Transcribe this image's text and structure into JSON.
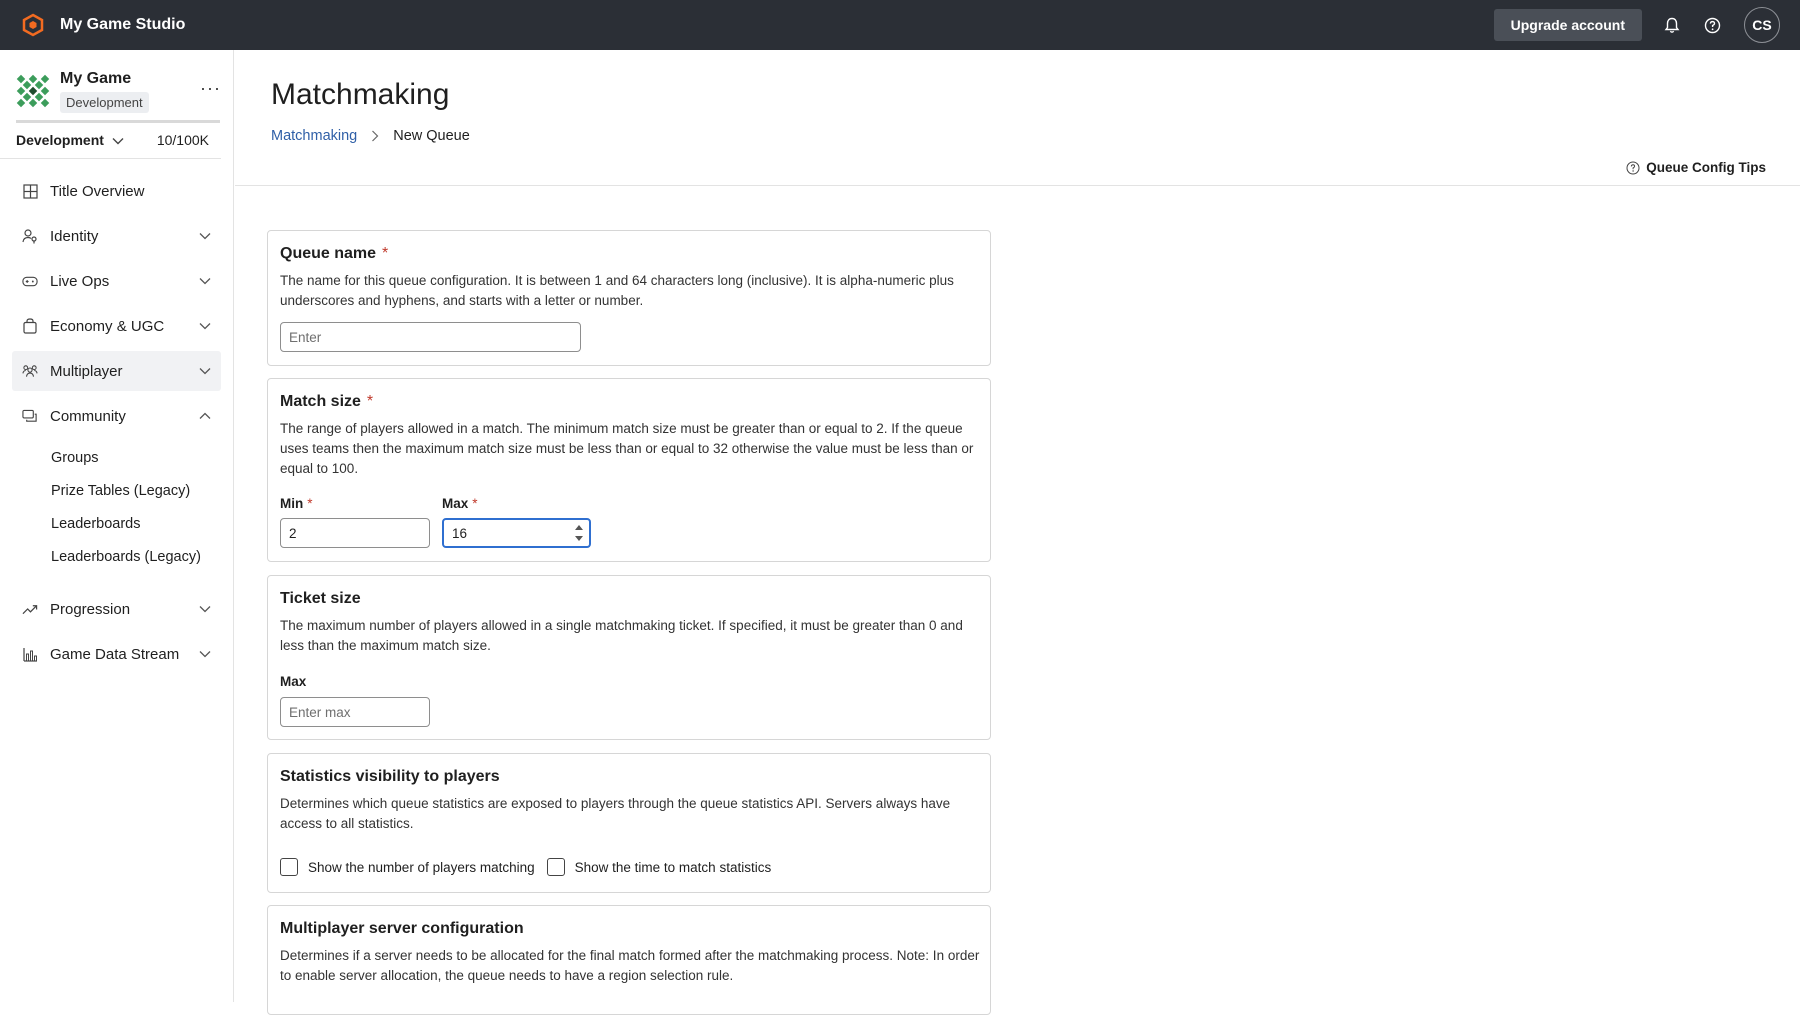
{
  "topbar": {
    "studio_name": "My Game Studio",
    "upgrade_label": "Upgrade account",
    "avatar_initials": "CS"
  },
  "sidebar": {
    "game_name": "My Game",
    "game_badge": "Development",
    "more_label": "···",
    "environment": "Development",
    "usage": "10/100K",
    "items": [
      {
        "label": "Title Overview",
        "icon": "grid-icon"
      },
      {
        "label": "Identity",
        "icon": "person-key-icon"
      },
      {
        "label": "Live Ops",
        "icon": "gamepad-icon"
      },
      {
        "label": "Economy & UGC",
        "icon": "shopping-bag-icon"
      },
      {
        "label": "Multiplayer",
        "icon": "people-icon"
      },
      {
        "label": "Community",
        "icon": "chat-icon"
      },
      {
        "label": "Progression",
        "icon": "trend-up-icon"
      },
      {
        "label": "Game Data Stream",
        "icon": "bar-chart-icon"
      }
    ],
    "community_sub": [
      "Groups",
      "Prize Tables (Legacy)",
      "Leaderboards",
      "Leaderboards (Legacy)"
    ]
  },
  "main": {
    "title": "Matchmaking",
    "breadcrumb_link": "Matchmaking",
    "breadcrumb_current": "New Queue",
    "tips_label": "Queue Config Tips",
    "required_mark": "*",
    "queue_name": {
      "title": "Queue name",
      "description": "The name for this queue configuration. It is between 1 and 64 characters long (inclusive). It is alpha-numeric plus underscores and hyphens, and starts with a letter or number.",
      "placeholder": "Enter",
      "value": ""
    },
    "match_size": {
      "title": "Match size",
      "description": "The range of players allowed in a match. The minimum match size must be greater than or equal to 2. If the queue uses teams then the maximum match size must be less than or equal to 32 otherwise the value must be less than or equal to 100.",
      "min_label": "Min",
      "min_value": "2",
      "max_label": "Max",
      "max_value": "16"
    },
    "ticket_size": {
      "title": "Ticket size",
      "description": "The maximum number of players allowed in a single matchmaking ticket. If specified, it must be greater than 0 and less than the maximum match size.",
      "max_label": "Max",
      "max_placeholder": "Enter max"
    },
    "statistics": {
      "title": "Statistics visibility to players",
      "description": "Determines which queue statistics are exposed to players through the queue statistics API. Servers always have access to all statistics.",
      "option1": "Show the number of players matching",
      "option2": "Show the time to match statistics"
    },
    "server_config": {
      "title": "Multiplayer server configuration",
      "description": "Determines if a server needs to be allocated for the final match formed after the matchmaking process. Note: In order to enable server allocation, the queue needs to have a region selection rule."
    }
  },
  "colors": {
    "topbar_bg": "#2b2f36",
    "accent_orange": "#f26b21",
    "link_blue": "#2f5fa7",
    "focus_blue": "#2f6fd0",
    "required_red": "#c0392b"
  }
}
